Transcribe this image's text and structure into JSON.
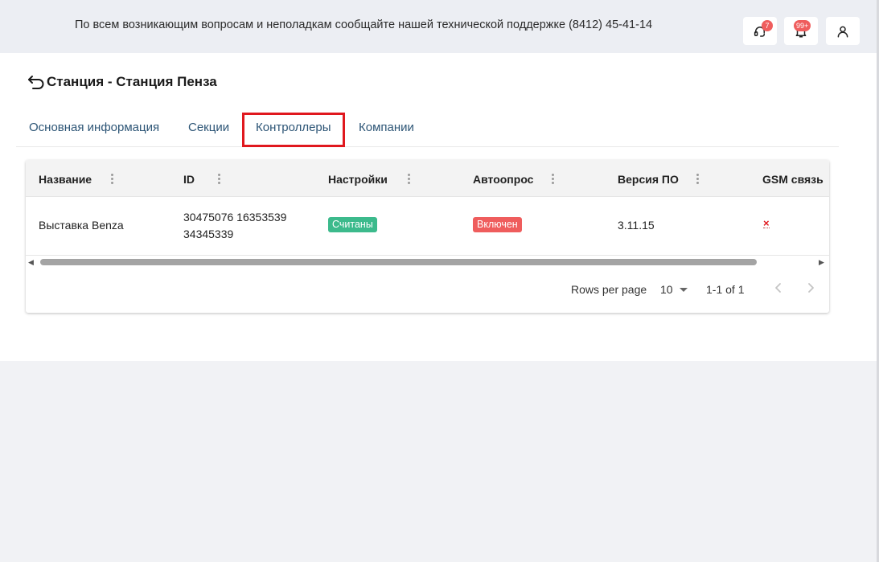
{
  "header": {
    "notice": "По всем возникающим вопросам и неполадкам сообщайте нашей технической поддержке (8412) 45-41-14",
    "support_badge": "7",
    "notifications_badge": "99+"
  },
  "page": {
    "title": "Станция - Станция Пенза"
  },
  "tabs": [
    {
      "label": "Основная информация"
    },
    {
      "label": "Секции"
    },
    {
      "label": "Контроллеры"
    },
    {
      "label": "Компании"
    }
  ],
  "table": {
    "columns": [
      "Название",
      "ID",
      "Настройки",
      "Автоопрос",
      "Версия ПО",
      "GSM связь"
    ],
    "rows": [
      {
        "name": "Выставка Benza",
        "id_line1": "30475076 16353539",
        "id_line2": "34345339",
        "settings": "Считаны",
        "autopoll": "Включен",
        "version": "3.11.15",
        "gsm": "×"
      }
    ]
  },
  "pagination": {
    "rows_per_page_label": "Rows per page",
    "rows_per_page_value": "10",
    "range": "1-1 of 1"
  },
  "colors": {
    "chip_success": "#3cba8c",
    "chip_danger": "#ef5d5d",
    "tab_text": "#2d5576",
    "highlight": "#e0181e"
  },
  "icons": {
    "back": "back-arrow-icon",
    "support": "headset-icon",
    "notifications": "bell-icon",
    "profile": "user-icon"
  }
}
